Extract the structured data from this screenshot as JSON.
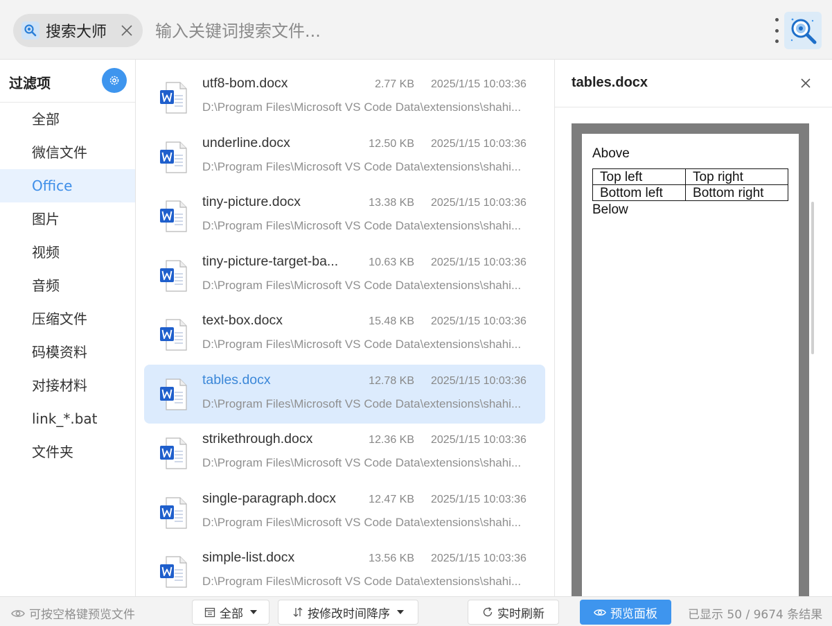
{
  "app": {
    "name": "搜索大师",
    "search_placeholder": "输入关键词搜索文件...",
    "logo_icon": "magnifier-search-icon"
  },
  "sidebar": {
    "title": "过滤项",
    "items": [
      {
        "label": "全部",
        "active": false
      },
      {
        "label": "微信文件",
        "active": false
      },
      {
        "label": "Office",
        "active": true
      },
      {
        "label": "图片",
        "active": false
      },
      {
        "label": "视频",
        "active": false
      },
      {
        "label": "音频",
        "active": false
      },
      {
        "label": "压缩文件",
        "active": false
      },
      {
        "label": "码模资料",
        "active": false
      },
      {
        "label": "对接材料",
        "active": false
      },
      {
        "label": "link_*.bat",
        "active": false
      },
      {
        "label": "文件夹",
        "active": false
      }
    ]
  },
  "files": [
    {
      "name": "utf8-bom.docx",
      "size": "2.77 KB",
      "date": "2025/1/15 10:03:36",
      "path": "D:\\Program Files\\Microsoft VS Code Data\\extensions\\shahi...",
      "selected": false
    },
    {
      "name": "underline.docx",
      "size": "12.50 KB",
      "date": "2025/1/15 10:03:36",
      "path": "D:\\Program Files\\Microsoft VS Code Data\\extensions\\shahi...",
      "selected": false
    },
    {
      "name": "tiny-picture.docx",
      "size": "13.38 KB",
      "date": "2025/1/15 10:03:36",
      "path": "D:\\Program Files\\Microsoft VS Code Data\\extensions\\shahi...",
      "selected": false
    },
    {
      "name": "tiny-picture-target-ba...",
      "size": "10.63 KB",
      "date": "2025/1/15 10:03:36",
      "path": "D:\\Program Files\\Microsoft VS Code Data\\extensions\\shahi...",
      "selected": false
    },
    {
      "name": "text-box.docx",
      "size": "15.48 KB",
      "date": "2025/1/15 10:03:36",
      "path": "D:\\Program Files\\Microsoft VS Code Data\\extensions\\shahi...",
      "selected": false
    },
    {
      "name": "tables.docx",
      "size": "12.78 KB",
      "date": "2025/1/15 10:03:36",
      "path": "D:\\Program Files\\Microsoft VS Code Data\\extensions\\shahi...",
      "selected": true
    },
    {
      "name": "strikethrough.docx",
      "size": "12.36 KB",
      "date": "2025/1/15 10:03:36",
      "path": "D:\\Program Files\\Microsoft VS Code Data\\extensions\\shahi...",
      "selected": false
    },
    {
      "name": "single-paragraph.docx",
      "size": "12.47 KB",
      "date": "2025/1/15 10:03:36",
      "path": "D:\\Program Files\\Microsoft VS Code Data\\extensions\\shahi...",
      "selected": false
    },
    {
      "name": "simple-list.docx",
      "size": "13.56 KB",
      "date": "2025/1/15 10:03:36",
      "path": "D:\\Program Files\\Microsoft VS Code Data\\extensions\\shahi...",
      "selected": false
    }
  ],
  "preview": {
    "title": "tables.docx",
    "doc": {
      "above": "Above",
      "table": [
        [
          "Top left",
          "Top right"
        ],
        [
          "Bottom left",
          "Bottom right"
        ]
      ],
      "below": "Below"
    }
  },
  "statusbar": {
    "hint": "可按空格键预览文件",
    "filter_label": "全部",
    "sort_label": "按修改时间降序",
    "refresh_label": "实时刷新",
    "preview_label": "预览面板",
    "result_count": "已显示 50 / 9674 条结果"
  },
  "colors": {
    "accent": "#3e95ee",
    "selected_row_bg": "#dcebfd",
    "active_sidebar_bg": "#e8f2fe",
    "word_icon_blue": "#1f5fcc"
  }
}
